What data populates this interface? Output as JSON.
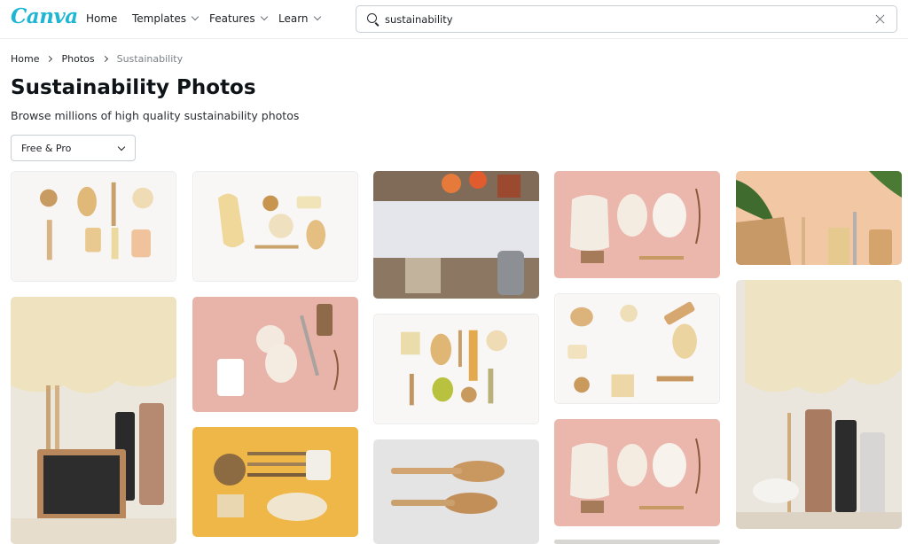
{
  "header": {
    "logo": "Canva",
    "nav": [
      {
        "label": "Home",
        "has_menu": false
      },
      {
        "label": "Templates",
        "has_menu": true
      },
      {
        "label": "Features",
        "has_menu": true
      },
      {
        "label": "Learn",
        "has_menu": true
      }
    ],
    "search": {
      "value": "sustainability",
      "icon": "search-icon",
      "clear_icon": "close-icon"
    }
  },
  "breadcrumb": [
    {
      "label": "Home",
      "current": false
    },
    {
      "label": "Photos",
      "current": false
    },
    {
      "label": "Sustainability",
      "current": true
    }
  ],
  "page": {
    "title": "Sustainability Photos",
    "subtitle": "Browse millions of high quality sustainability photos",
    "filter": {
      "selected": "Free & Pro",
      "icon": "chevron-down-icon"
    }
  },
  "colors": {
    "brand": "#1fb6d3",
    "text": "#0e1318",
    "border": "#c9ced6"
  }
}
